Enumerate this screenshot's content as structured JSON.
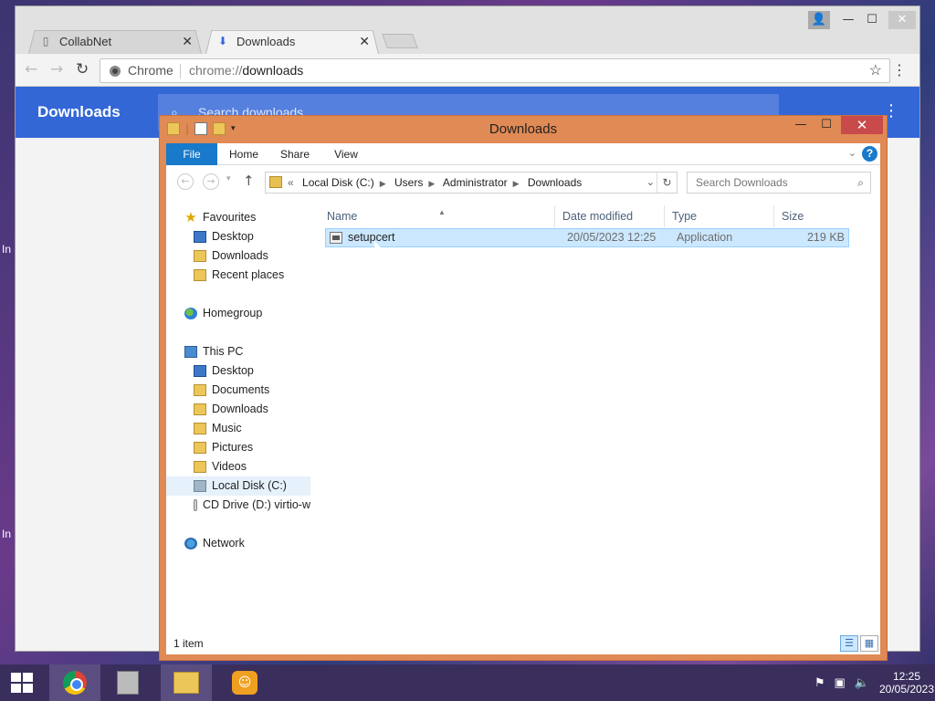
{
  "browser": {
    "tabs": [
      {
        "label": "CollabNet",
        "icon": "page-icon"
      },
      {
        "label": "Downloads",
        "icon": "download-icon"
      }
    ],
    "omnibox": {
      "chip": "Chrome",
      "url_scheme": "chrome://",
      "url_host": "downloads"
    },
    "page": {
      "title": "Downloads",
      "search_placeholder": "Search downloads"
    }
  },
  "explorer": {
    "title": "Downloads",
    "ribbon_tabs": [
      "File",
      "Home",
      "Share",
      "View"
    ],
    "address": [
      "Local Disk (C:)",
      "Users",
      "Administrator",
      "Downloads"
    ],
    "address_prefix": "«",
    "search_placeholder": "Search Downloads",
    "nav": {
      "favourites": "Favourites",
      "fav_items": [
        "Desktop",
        "Downloads",
        "Recent places"
      ],
      "homegroup": "Homegroup",
      "thispc": "This PC",
      "pc_items": [
        "Desktop",
        "Documents",
        "Downloads",
        "Music",
        "Pictures",
        "Videos",
        "Local Disk (C:)",
        "CD Drive (D:) virtio-w"
      ],
      "network": "Network"
    },
    "columns": [
      "Name",
      "Date modified",
      "Type",
      "Size"
    ],
    "files": [
      {
        "name": "setupcert",
        "date": "20/05/2023 12:25",
        "type": "Application",
        "size": "219 KB"
      }
    ],
    "status": "1 item"
  },
  "taskbar": {
    "time": "12:25",
    "date": "20/05/2023"
  },
  "colors": {
    "accent": "#3367d6",
    "explorer_frame": "#e08a55",
    "ribbon_file": "#1979ca",
    "selection": "#cce8ff"
  }
}
